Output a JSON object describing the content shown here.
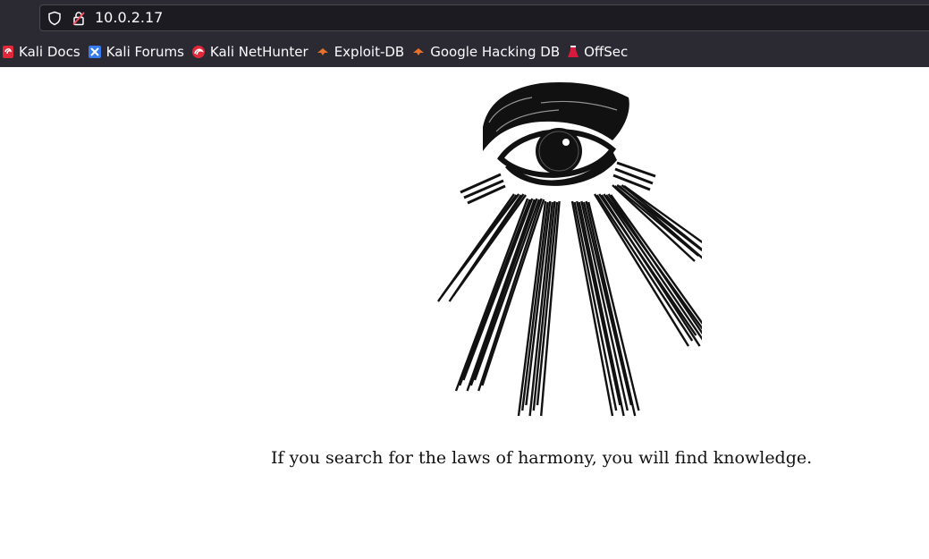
{
  "browser": {
    "url": "10.0.2.17",
    "bookmarks": [
      {
        "label": "Kali Docs",
        "icon": "kali-docs-icon",
        "color": "#e0283a"
      },
      {
        "label": "Kali Forums",
        "icon": "kali-forums-icon",
        "color": "#367bf0"
      },
      {
        "label": "Kali NetHunter",
        "icon": "kali-nethunter-icon",
        "color": "#e0283a"
      },
      {
        "label": "Exploit-DB",
        "icon": "exploit-db-icon",
        "color": "#e8702a"
      },
      {
        "label": "Google Hacking DB",
        "icon": "ghdb-icon",
        "color": "#e8702a"
      },
      {
        "label": "OffSec",
        "icon": "offsec-icon",
        "color": "#d81b3c"
      }
    ]
  },
  "page": {
    "image": "all-seeing-eye-illustration",
    "motto": "If you search for the laws of harmony, you will find knowledge."
  }
}
